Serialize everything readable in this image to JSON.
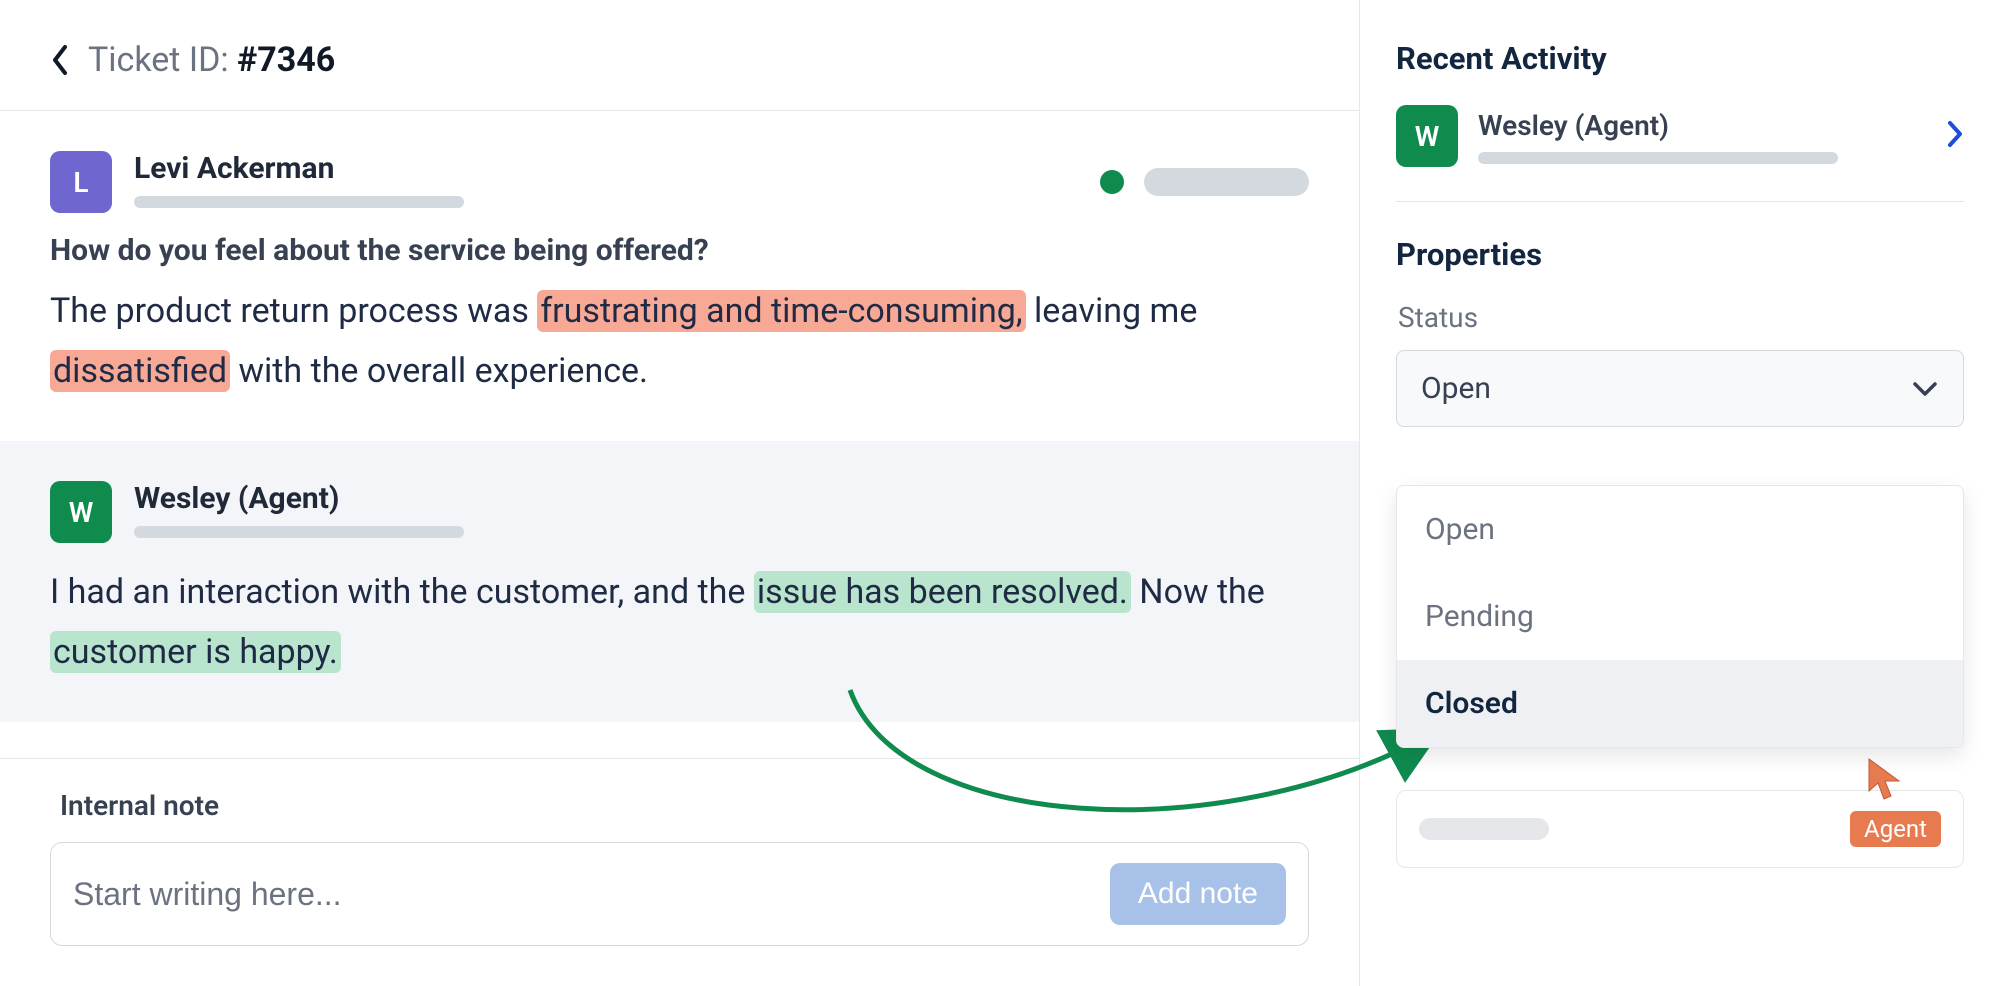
{
  "header": {
    "ticket_label": "Ticket ID: ",
    "ticket_id": "#7346"
  },
  "messages": {
    "customer": {
      "avatar_initial": "L",
      "name": "Levi Ackerman",
      "question": "How do you feel about the service being offered?",
      "body_pre": "The product return process was ",
      "body_neg1": "frustrating and time-consuming,",
      "body_mid1": " leaving me ",
      "body_neg2": "dissatisfied",
      "body_post": " with the overall experience."
    },
    "agent": {
      "avatar_initial": "W",
      "name": "Wesley (Agent)",
      "body_pre": "I had an interaction with the customer, and the ",
      "body_pos1": "issue has been resolved.",
      "body_mid": " Now the ",
      "body_pos2": "customer is happy."
    }
  },
  "note": {
    "label": "Internal note",
    "placeholder": "Start writing here...",
    "button": "Add note"
  },
  "sidebar": {
    "recent_activity_heading": "Recent Activity",
    "activity_name": "Wesley (Agent)",
    "activity_initial": "W",
    "properties_heading": "Properties",
    "status_label": "Status",
    "status_value": "Open",
    "status_options": [
      "Open",
      "Pending",
      "Closed"
    ],
    "agent_badge": "Agent"
  }
}
